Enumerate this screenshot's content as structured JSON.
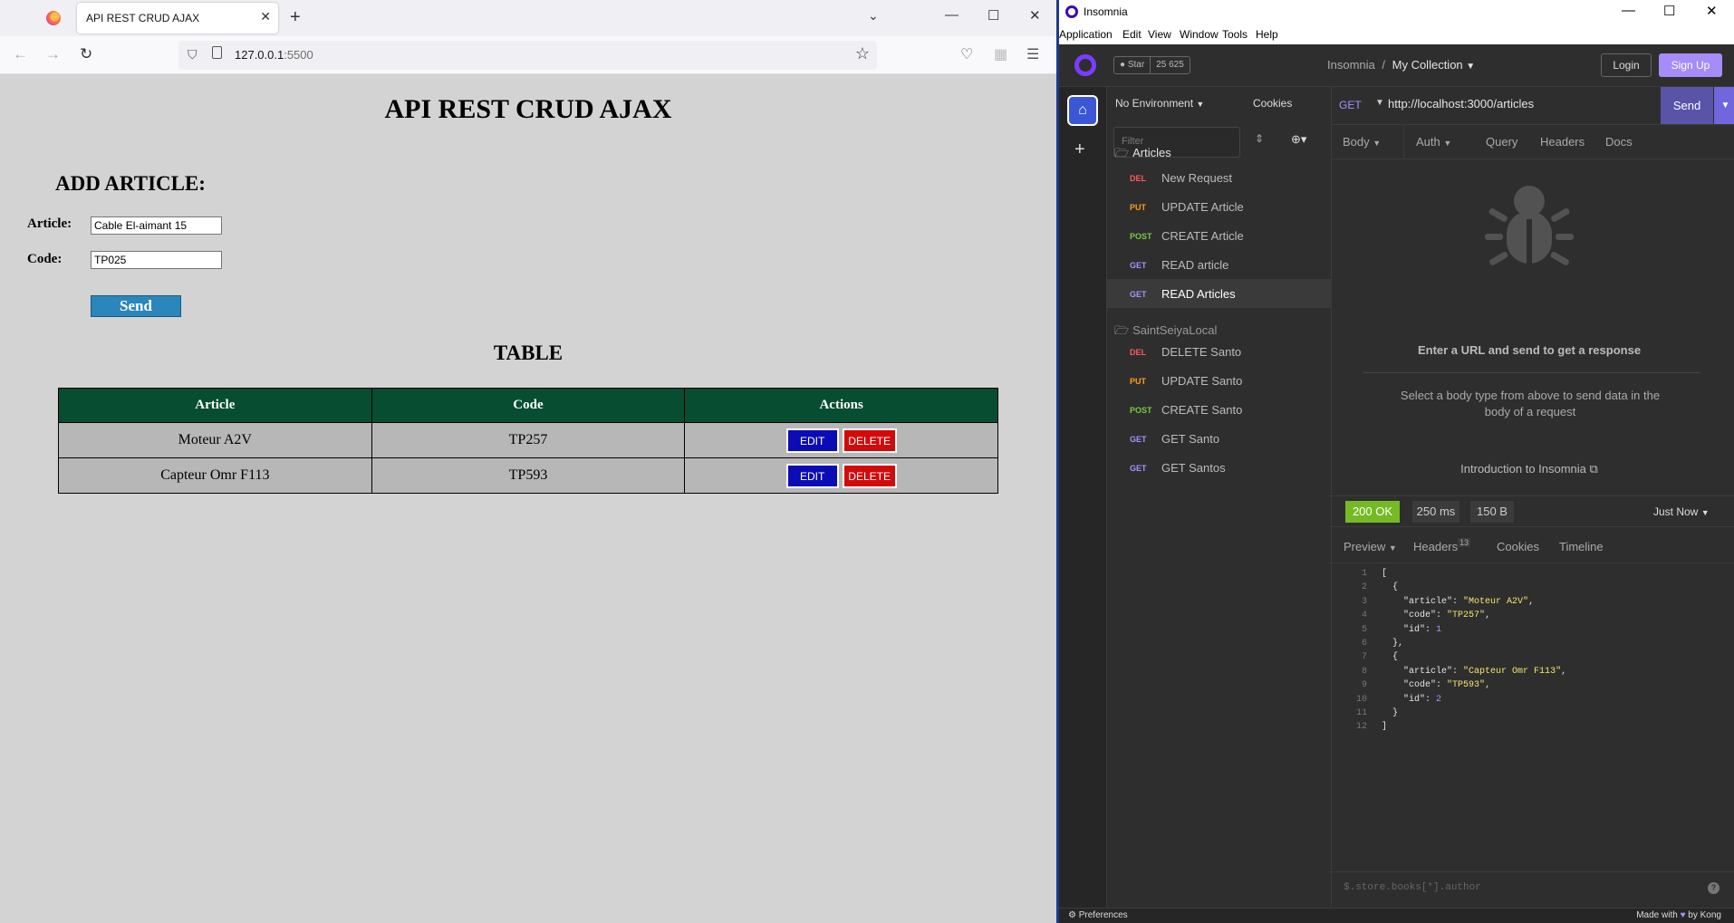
{
  "browser": {
    "tab_title": "API REST CRUD AJAX",
    "url_host": "127.0.0.1",
    "url_port": ":5500"
  },
  "page": {
    "title": "API REST CRUD AJAX",
    "add_heading": "ADD ARTICLE:",
    "article_label": "Article:",
    "article_value": "Cable El-aimant 15",
    "code_label": "Code:",
    "code_value": "TP025",
    "send_label": "Send",
    "table_heading": "TABLE",
    "table": {
      "headers": [
        "Article",
        "Code",
        "Actions"
      ],
      "rows": [
        {
          "article": "Moteur A2V",
          "code": "TP257"
        },
        {
          "article": "Capteur Omr F113",
          "code": "TP593"
        }
      ],
      "edit_label": "EDIT",
      "delete_label": "DELETE"
    }
  },
  "insomnia": {
    "window_title": "Insomnia",
    "menu": [
      "Application",
      "Edit",
      "View",
      "Window",
      "Tools",
      "Help"
    ],
    "star_label": "Star",
    "star_count": "25 625",
    "breadcrumb_root": "Insomnia",
    "breadcrumb_sep": "/",
    "collection": "My Collection",
    "login_label": "Login",
    "signup_label": "Sign Up",
    "environment": "No Environment",
    "cookies_label": "Cookies",
    "filter_placeholder": "Filter",
    "folders": [
      {
        "name": "Articles",
        "requests": [
          {
            "method": "DEL",
            "name": "New Request"
          },
          {
            "method": "PUT",
            "name": "UPDATE Article"
          },
          {
            "method": "POST",
            "name": "CREATE Article"
          },
          {
            "method": "GET",
            "name": "READ article"
          },
          {
            "method": "GET",
            "name": "READ Articles"
          }
        ]
      },
      {
        "name": "SaintSeiyaLocal",
        "requests": [
          {
            "method": "DEL",
            "name": "DELETE Santo"
          },
          {
            "method": "PUT",
            "name": "UPDATE Santo"
          },
          {
            "method": "POST",
            "name": "CREATE Santo"
          },
          {
            "method": "GET",
            "name": "GET Santo"
          },
          {
            "method": "GET",
            "name": "GET Santos"
          }
        ]
      }
    ],
    "request": {
      "method": "GET",
      "url": "http://localhost:3000/articles",
      "send_label": "Send",
      "tabs": [
        "Body",
        "Auth",
        "Query",
        "Headers",
        "Docs"
      ]
    },
    "empty_title": "Enter a URL and send to get a response",
    "empty_body": "Select a body type from above to send data in the body of a request",
    "intro_link": "Introduction to Insomnia",
    "response": {
      "status": "200 OK",
      "time": "250 ms",
      "size": "150 B",
      "when": "Just Now",
      "tabs": [
        "Preview",
        "Headers",
        "Cookies",
        "Timeline"
      ],
      "headers_count": "13",
      "line_numbers": [
        "1",
        "2",
        "3",
        "4",
        "5",
        "6",
        "7",
        "8",
        "9",
        "10",
        "11",
        "12"
      ],
      "json_keys": [
        "\"article\"",
        "\"code\"",
        "\"id\""
      ],
      "items": [
        {
          "article": "\"Moteur A2V\"",
          "code": "\"TP257\"",
          "id": "1"
        },
        {
          "article": "\"Capteur Omr F113\"",
          "code": "\"TP593\"",
          "id": "2"
        }
      ],
      "jsonpath_placeholder": "$.store.books[*].author"
    },
    "preferences_label": "Preferences",
    "made_with": "Made with",
    "by_kong": "by Kong",
    "colors": {
      "accent": "#a692ff",
      "send": "#5a54a8",
      "status_ok": "#75ba24",
      "method_del": "#ff5a5a",
      "method_put": "#ff9a1f",
      "method_post": "#7ac943",
      "method_get": "#a692ff"
    }
  }
}
